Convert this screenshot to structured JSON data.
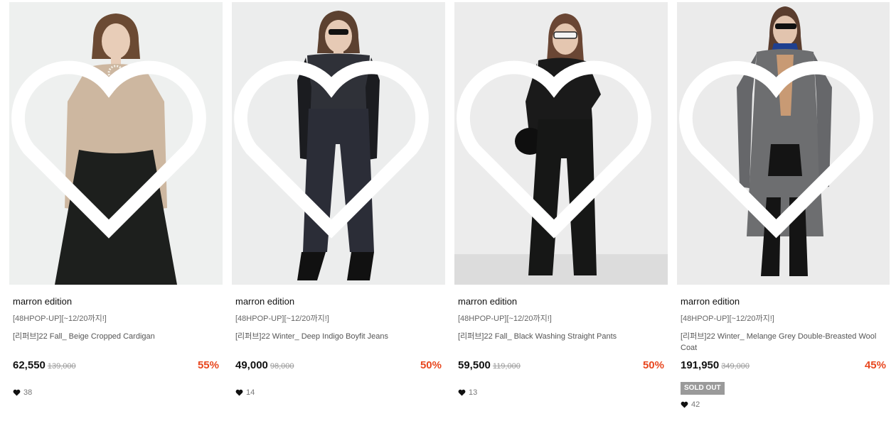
{
  "products": [
    {
      "brand": "marron edition",
      "promo": "[48HPOP-UP][~12/20까지!]",
      "name": "[리퍼브]22 Fall_ Beige Cropped Cardigan",
      "price": "62,550",
      "original_price": "139,000",
      "discount": "55%",
      "likes": "38",
      "colors": {
        "bg": "#eef0ef",
        "top": "#cdb7a0",
        "bottom": "#1d1f1d",
        "hair": "#6b4a33"
      }
    },
    {
      "brand": "marron edition",
      "promo": "[48HPOP-UP][~12/20까지!]",
      "name": "[리퍼브]22 Winter_ Deep Indigo Boyfit Jeans",
      "price": "49,000",
      "original_price": "98,000",
      "discount": "50%",
      "likes": "14",
      "colors": {
        "bg": "#eceded",
        "top": "#2f3138",
        "bottom": "#2b2d37",
        "hair": "#5c4130"
      }
    },
    {
      "brand": "marron edition",
      "promo": "[48HPOP-UP][~12/20까지!]",
      "name": "[리퍼브]22 Fall_ Black Washing Straight Pants",
      "price": "59,500",
      "original_price": "119,000",
      "discount": "50%",
      "likes": "13",
      "colors": {
        "bg": "#ececec",
        "top": "#1a1a1a",
        "bottom": "#161716",
        "hair": "#6a4634"
      }
    },
    {
      "brand": "marron edition",
      "promo": "[48HPOP-UP][~12/20까지!]",
      "name": "[리퍼브]22 Winter_ Melange Grey Double-Breasted Wool Coat",
      "price": "191,950",
      "original_price": "349,000",
      "discount": "45%",
      "badge": "SOLD OUT",
      "likes": "42",
      "colors": {
        "bg": "#ebebeb",
        "top": "#6d6e70",
        "bottom": "#141414",
        "hair": "#5a3d2e"
      }
    }
  ],
  "accent_color": "#e8471f"
}
